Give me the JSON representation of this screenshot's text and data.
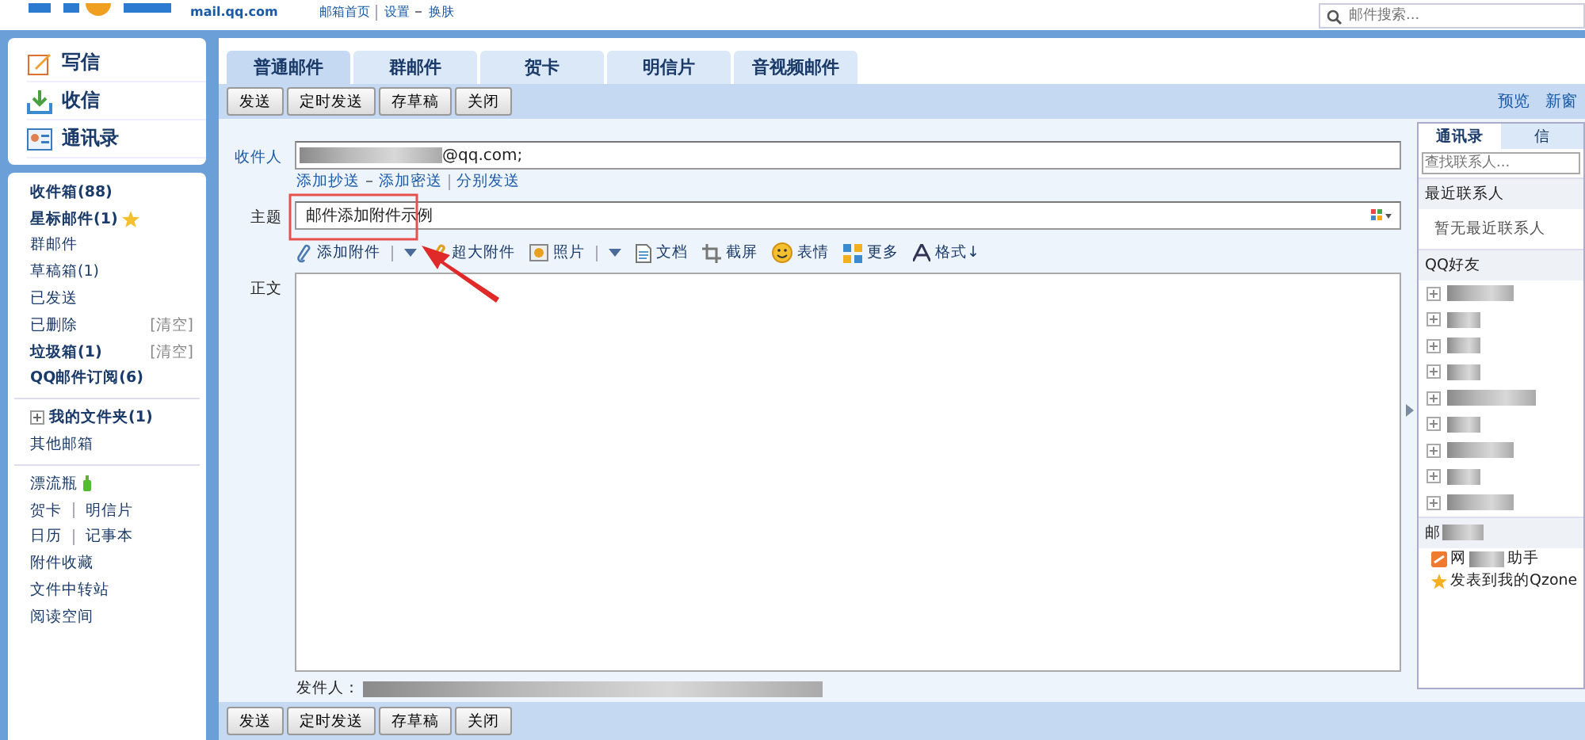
{
  "header": {
    "domain": "mail.qq.com",
    "links": [
      "邮箱首页",
      "设置",
      "换肤"
    ],
    "search": {
      "placeholder": "邮件搜索..."
    }
  },
  "sidebar": {
    "actions": [
      {
        "label": "写信",
        "kind": "write"
      },
      {
        "label": "收信",
        "kind": "inbox"
      },
      {
        "label": "通讯录",
        "kind": "contacts"
      }
    ],
    "groups": [
      [
        {
          "label": "收件箱(88)",
          "bold": true
        },
        {
          "label": "星标邮件(1)",
          "bold": true,
          "kind": "star"
        },
        {
          "label": "群邮件",
          "bold": false
        },
        {
          "label": "草稿箱(1)",
          "bold": false
        },
        {
          "label": "已发送",
          "bold": false
        },
        {
          "label": "已删除",
          "bold": false,
          "action": "[清空]"
        },
        {
          "label": "垃圾箱(1)",
          "bold": true,
          "action": "[清空]"
        },
        {
          "label": "QQ邮件订阅(6)",
          "bold": true
        }
      ],
      [
        {
          "label": "我的文件夹(1)",
          "bold": true,
          "kind": "folder"
        },
        {
          "label": "其他邮箱",
          "bold": false
        }
      ],
      [
        {
          "label": "漂流瓶",
          "bold": false,
          "kind": "bottle"
        },
        {
          "label": "贺卡",
          "bold": false,
          "extra": "明信片"
        },
        {
          "label": "日历",
          "bold": false,
          "extra": "记事本"
        },
        {
          "label": "附件收藏",
          "bold": false
        },
        {
          "label": "文件中转站",
          "bold": false
        },
        {
          "label": "阅读空间",
          "bold": false
        }
      ]
    ]
  },
  "tabs": [
    {
      "label": "普通邮件",
      "selected": true
    },
    {
      "label": "群邮件",
      "selected": false
    },
    {
      "label": "贺卡",
      "selected": false
    },
    {
      "label": "明信片",
      "selected": false
    },
    {
      "label": "音视频邮件",
      "selected": false
    }
  ],
  "buttons": [
    "发送",
    "定时发送",
    "存草稿",
    "关闭"
  ],
  "toolbar_links": [
    "预览",
    "新窗"
  ],
  "compose": {
    "to_label": "收件人",
    "to_value": "@qq.com;",
    "to_links": [
      "添加抄送",
      "添加密送",
      "分别发送"
    ],
    "subject_label": "主题",
    "subject_value": "邮件添加附件示例",
    "tools": [
      {
        "label": "添加附件",
        "kind": "clip",
        "menu": true
      },
      {
        "label": "超大附件",
        "kind": "bigclip",
        "menu": false
      },
      {
        "label": "照片",
        "kind": "photo",
        "menu": true
      },
      {
        "label": "文档",
        "kind": "doc",
        "menu": false
      },
      {
        "label": "截屏",
        "kind": "cut",
        "menu": false
      },
      {
        "label": "表情",
        "kind": "smile",
        "menu": false
      },
      {
        "label": "更多",
        "kind": "more",
        "menu": false
      },
      {
        "label": "格式↓",
        "kind": "format",
        "menu": false
      }
    ],
    "body_label": "正文",
    "sender_label": "发件人："
  },
  "bottom_buttons": [
    "发送",
    "定时发送",
    "存草稿",
    "关闭"
  ],
  "contacts": {
    "tabs": [
      {
        "label": "通讯录",
        "selected": true
      },
      {
        "label": "信",
        "selected": false
      }
    ],
    "search": {
      "placeholder": "查找联系人..."
    },
    "recent_title": "最近联系人",
    "recent_empty": "暂无最近联系人",
    "friends_title": "QQ好友",
    "mail_title": "邮",
    "apps": [
      {
        "label": "网",
        "tail": "助手",
        "kind": "app"
      },
      {
        "label": "发表到我的Qzone",
        "kind": "star"
      }
    ]
  }
}
